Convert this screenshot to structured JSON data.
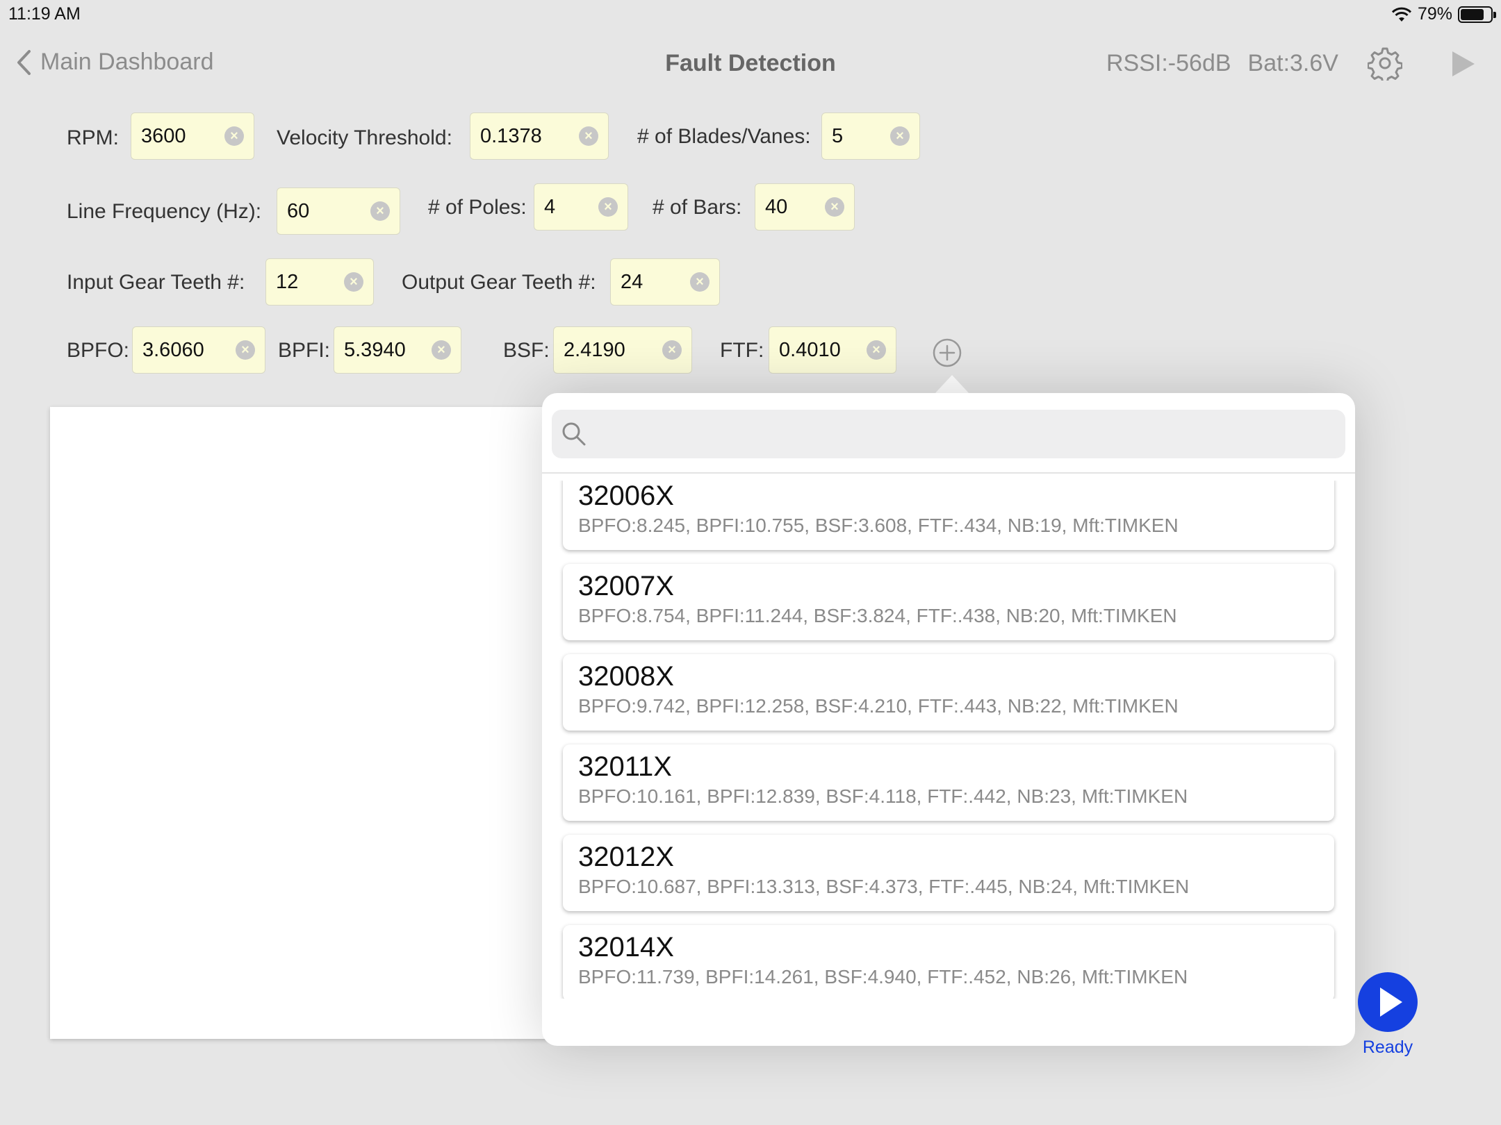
{
  "status_bar": {
    "time": "11:19 AM",
    "battery_percent": "79%",
    "battery_level": 0.79
  },
  "nav": {
    "back_label": "Main Dashboard",
    "title": "Fault Detection",
    "rssi": "RSSI:-56dB",
    "battery_voltage": "Bat:3.6V"
  },
  "params": {
    "rpm": {
      "label": "RPM:",
      "value": "3600"
    },
    "velocity_threshold": {
      "label": "Velocity Threshold:",
      "value": "0.1378"
    },
    "blades": {
      "label": "# of Blades/Vanes:",
      "value": "5"
    },
    "line_frequency": {
      "label": "Line Frequency (Hz):",
      "value": "60"
    },
    "poles": {
      "label": "# of Poles:",
      "value": "4"
    },
    "bars": {
      "label": "# of Bars:",
      "value": "40"
    },
    "input_gear": {
      "label": "Input Gear Teeth #:",
      "value": "12"
    },
    "output_gear": {
      "label": "Output Gear Teeth #:",
      "value": "24"
    },
    "bpfo": {
      "label": "BPFO:",
      "value": "3.6060"
    },
    "bpfi": {
      "label": "BPFI:",
      "value": "5.3940"
    },
    "bsf": {
      "label": "BSF:",
      "value": "2.4190"
    },
    "ftf": {
      "label": "FTF:",
      "value": "0.4010"
    }
  },
  "popover": {
    "search_placeholder": "",
    "bearings": [
      {
        "name": "32006X",
        "details": "BPFO:8.245, BPFI:10.755, BSF:3.608, FTF:.434, NB:19, Mft:TIMKEN"
      },
      {
        "name": "32007X",
        "details": "BPFO:8.754, BPFI:11.244, BSF:3.824, FTF:.438, NB:20, Mft:TIMKEN"
      },
      {
        "name": "32008X",
        "details": "BPFO:9.742, BPFI:12.258, BSF:4.210, FTF:.443, NB:22, Mft:TIMKEN"
      },
      {
        "name": "32011X",
        "details": "BPFO:10.161, BPFI:12.839, BSF:4.118, FTF:.442, NB:23, Mft:TIMKEN"
      },
      {
        "name": "32012X",
        "details": "BPFO:10.687, BPFI:13.313, BSF:4.373, FTF:.445, NB:24, Mft:TIMKEN"
      },
      {
        "name": "32014X",
        "details": "BPFO:11.739, BPFI:14.261, BSF:4.940, FTF:.452, NB:26, Mft:TIMKEN"
      }
    ]
  },
  "run": {
    "label": "Ready",
    "color": "#1540e0"
  },
  "colors": {
    "field_bg": "#fbfbd9",
    "page_bg": "#e6e6e6",
    "accent": "#1540e0"
  }
}
